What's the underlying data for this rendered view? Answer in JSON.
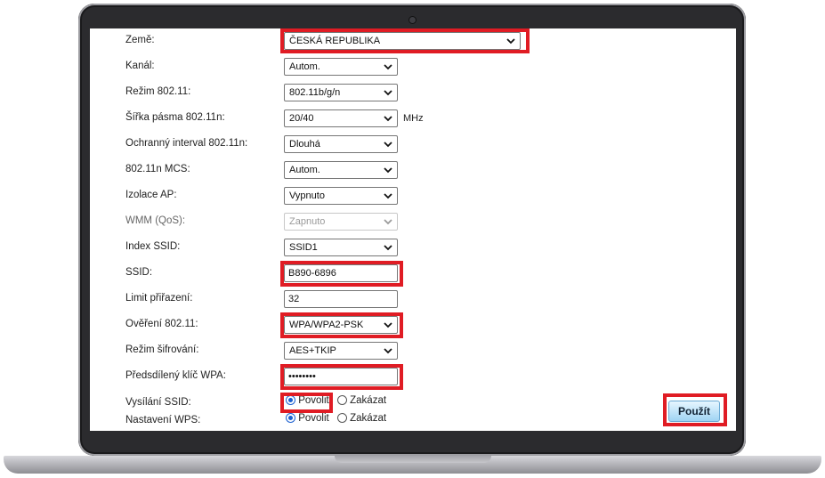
{
  "form": {
    "country": {
      "label": "Země:",
      "value": "ČESKÁ REPUBLIKA"
    },
    "channel": {
      "label": "Kanál:",
      "value": "Autom."
    },
    "mode": {
      "label": "Režim 802.11:",
      "value": "802.11b/g/n"
    },
    "bandwidth": {
      "label": "Šířka pásma 802.11n:",
      "value": "20/40",
      "unit": "MHz"
    },
    "guard_interval": {
      "label": "Ochranný interval 802.11n:",
      "value": "Dlouhá"
    },
    "mcs": {
      "label": "802.11n MCS:",
      "value": "Autom."
    },
    "ap_isolation": {
      "label": "Izolace AP:",
      "value": "Vypnuto"
    },
    "wmm": {
      "label": "WMM (QoS):",
      "value": "Zapnuto"
    },
    "ssid_index": {
      "label": "Index SSID:",
      "value": "SSID1"
    },
    "ssid": {
      "label": "SSID:",
      "value": "B890-6896"
    },
    "assoc_limit": {
      "label": "Limit přiřazení:",
      "value": "32"
    },
    "auth": {
      "label": "Ověření 802.11:",
      "value": "WPA/WPA2-PSK"
    },
    "encryption": {
      "label": "Režim šifrování:",
      "value": "AES+TKIP"
    },
    "psk": {
      "label": "Předsdílený klíč WPA:",
      "value": "••••••••"
    },
    "ssid_broadcast": {
      "label": "Vysílání SSID:",
      "enable": "Povolit",
      "disable": "Zakázat",
      "selected": "Povolit"
    },
    "wps": {
      "label": "Nastavení WPS:",
      "enable": "Povolit",
      "disable": "Zakázat",
      "selected": "Povolit"
    }
  },
  "apply_label": "Použít",
  "colors": {
    "highlight": "#e01c24",
    "button": "#9fd4f3",
    "frame": "#2b2b2e"
  }
}
